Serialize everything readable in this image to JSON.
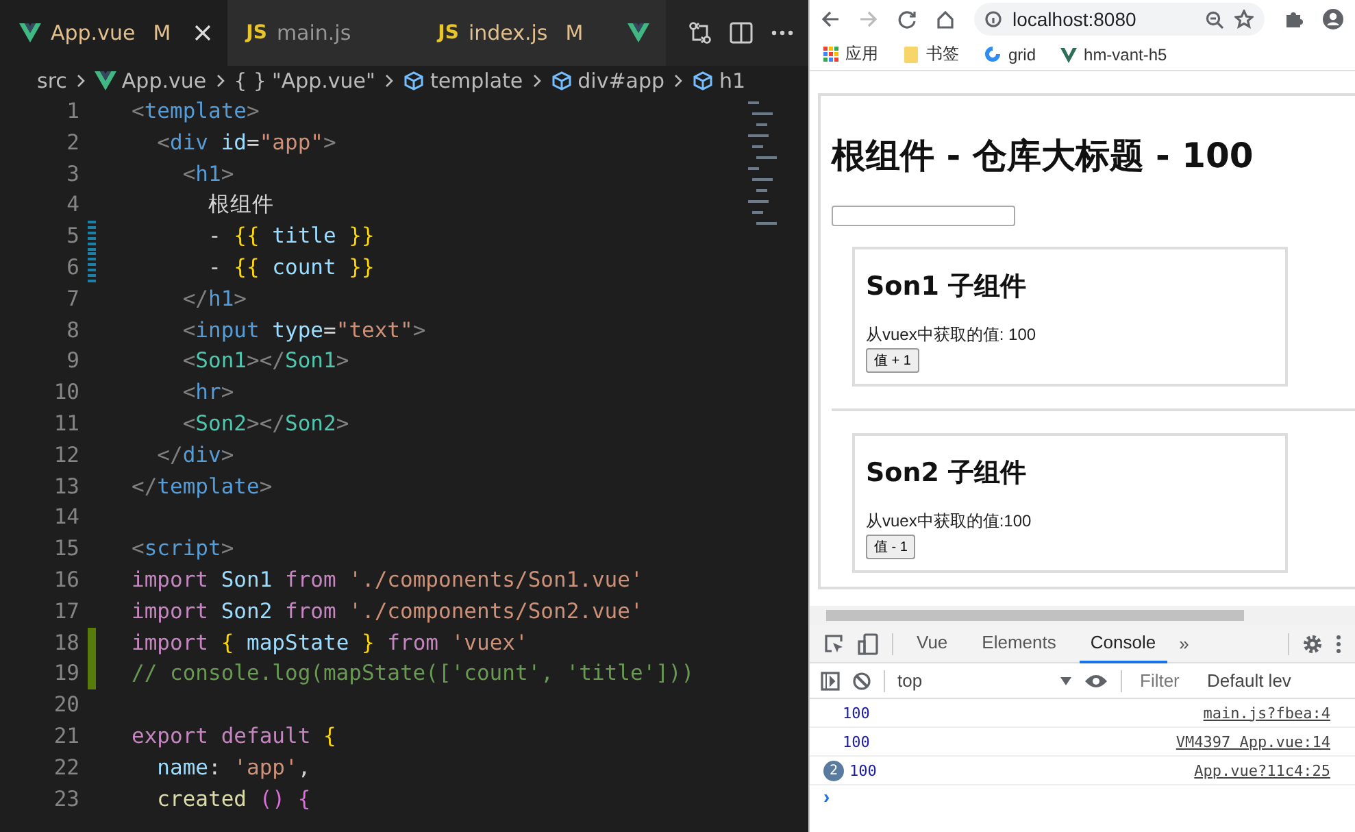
{
  "editor": {
    "tabs": [
      {
        "kind": "vue",
        "label": "App.vue",
        "badge": "M",
        "selected": true
      },
      {
        "kind": "js",
        "icon_text": "JS",
        "label": "main.js",
        "selected": false
      },
      {
        "kind": "js",
        "icon_text": "JS",
        "label": "index.js",
        "badge": "M",
        "selected": false
      },
      {
        "kind": "vue",
        "selected": false
      }
    ],
    "breadcrumb": [
      {
        "kind": "plain",
        "text": "src"
      },
      {
        "kind": "vue",
        "text": "App.vue"
      },
      {
        "kind": "braces",
        "icon_text": "{ }",
        "text": "\"App.vue\""
      },
      {
        "kind": "element",
        "text": "template"
      },
      {
        "kind": "element",
        "text": "div#app"
      },
      {
        "kind": "element",
        "text": "h1"
      }
    ],
    "lines": [
      {
        "number": "1",
        "modified": false,
        "added": false,
        "tokens": [
          {
            "kind": "punct",
            "text": "<"
          },
          {
            "kind": "tag",
            "text": "template"
          },
          {
            "kind": "punct",
            "text": ">"
          }
        ]
      },
      {
        "number": "2",
        "modified": false,
        "added": false,
        "tokens": [
          {
            "kind": "punct",
            "text": "  <"
          },
          {
            "kind": "tag",
            "text": "div"
          },
          {
            "kind": "attr",
            "text": " id"
          },
          {
            "kind": "text",
            "text": "="
          },
          {
            "kind": "string",
            "text": "\"app\""
          },
          {
            "kind": "punct",
            "text": ">"
          }
        ]
      },
      {
        "number": "3",
        "modified": false,
        "added": false,
        "tokens": [
          {
            "kind": "punct",
            "text": "    <"
          },
          {
            "kind": "tag",
            "text": "h1"
          },
          {
            "kind": "punct",
            "text": ">"
          }
        ]
      },
      {
        "number": "4",
        "modified": false,
        "added": false,
        "tokens": [
          {
            "kind": "text",
            "text": "      根组件"
          }
        ]
      },
      {
        "number": "5",
        "modified": true,
        "added": false,
        "tokens": [
          {
            "kind": "text",
            "text": "      - "
          },
          {
            "kind": "brace",
            "text": "{{"
          },
          {
            "kind": "var",
            "text": " title "
          },
          {
            "kind": "brace",
            "text": "}}"
          }
        ]
      },
      {
        "number": "6",
        "modified": true,
        "added": false,
        "tokens": [
          {
            "kind": "text",
            "text": "      - "
          },
          {
            "kind": "brace",
            "text": "{{"
          },
          {
            "kind": "var",
            "text": " count "
          },
          {
            "kind": "brace",
            "text": "}}"
          }
        ]
      },
      {
        "number": "7",
        "modified": false,
        "added": false,
        "tokens": [
          {
            "kind": "punct",
            "text": "    </"
          },
          {
            "kind": "tag",
            "text": "h1"
          },
          {
            "kind": "punct",
            "text": ">"
          }
        ]
      },
      {
        "number": "8",
        "modified": false,
        "added": false,
        "tokens": [
          {
            "kind": "punct",
            "text": "    <"
          },
          {
            "kind": "tag",
            "text": "input"
          },
          {
            "kind": "attr",
            "text": " type"
          },
          {
            "kind": "text",
            "text": "="
          },
          {
            "kind": "string",
            "text": "\"text\""
          },
          {
            "kind": "punct",
            "text": ">"
          }
        ]
      },
      {
        "number": "9",
        "modified": false,
        "added": false,
        "tokens": [
          {
            "kind": "punct",
            "text": "    <"
          },
          {
            "kind": "component",
            "text": "Son1"
          },
          {
            "kind": "punct",
            "text": "></"
          },
          {
            "kind": "component",
            "text": "Son1"
          },
          {
            "kind": "punct",
            "text": ">"
          }
        ]
      },
      {
        "number": "10",
        "modified": false,
        "added": false,
        "tokens": [
          {
            "kind": "punct",
            "text": "    <"
          },
          {
            "kind": "tag",
            "text": "hr"
          },
          {
            "kind": "punct",
            "text": ">"
          }
        ]
      },
      {
        "number": "11",
        "modified": false,
        "added": false,
        "tokens": [
          {
            "kind": "punct",
            "text": "    <"
          },
          {
            "kind": "component",
            "text": "Son2"
          },
          {
            "kind": "punct",
            "text": "></"
          },
          {
            "kind": "component",
            "text": "Son2"
          },
          {
            "kind": "punct",
            "text": ">"
          }
        ]
      },
      {
        "number": "12",
        "modified": false,
        "added": false,
        "tokens": [
          {
            "kind": "punct",
            "text": "  </"
          },
          {
            "kind": "tag",
            "text": "div"
          },
          {
            "kind": "punct",
            "text": ">"
          }
        ]
      },
      {
        "number": "13",
        "modified": false,
        "added": false,
        "tokens": [
          {
            "kind": "punct",
            "text": "</"
          },
          {
            "kind": "tag",
            "text": "template"
          },
          {
            "kind": "punct",
            "text": ">"
          }
        ]
      },
      {
        "number": "14",
        "modified": false,
        "added": false
      },
      {
        "number": "15",
        "modified": false,
        "added": false,
        "tokens": [
          {
            "kind": "punct",
            "text": "<"
          },
          {
            "kind": "tag",
            "text": "script"
          },
          {
            "kind": "punct",
            "text": ">"
          }
        ]
      },
      {
        "number": "16",
        "modified": false,
        "added": false,
        "tokens": [
          {
            "kind": "keyword",
            "text": "import"
          },
          {
            "kind": "var",
            "text": " Son1"
          },
          {
            "kind": "keyword",
            "text": " from"
          },
          {
            "kind": "string",
            "text": " './components/Son1.vue'"
          }
        ]
      },
      {
        "number": "17",
        "modified": false,
        "added": false,
        "tokens": [
          {
            "kind": "keyword",
            "text": "import"
          },
          {
            "kind": "var",
            "text": " Son2"
          },
          {
            "kind": "keyword",
            "text": " from"
          },
          {
            "kind": "string",
            "text": " './components/Son2.vue'"
          }
        ]
      },
      {
        "number": "18",
        "modified": false,
        "added": true,
        "tokens": [
          {
            "kind": "keyword",
            "text": "import"
          },
          {
            "kind": "brace",
            "text": " {"
          },
          {
            "kind": "var",
            "text": " mapState"
          },
          {
            "kind": "brace",
            "text": " }"
          },
          {
            "kind": "keyword",
            "text": " from"
          },
          {
            "kind": "string",
            "text": " 'vuex'"
          }
        ]
      },
      {
        "number": "19",
        "modified": false,
        "added": true,
        "tokens": [
          {
            "kind": "comment",
            "text": "// console.log(mapState(['count', 'title']))"
          }
        ]
      },
      {
        "number": "20",
        "modified": false,
        "added": false
      },
      {
        "number": "21",
        "modified": false,
        "added": false,
        "tokens": [
          {
            "kind": "keyword",
            "text": "export default"
          },
          {
            "kind": "brace",
            "text": " {"
          }
        ]
      },
      {
        "number": "22",
        "modified": false,
        "added": false,
        "tokens": [
          {
            "kind": "prop",
            "text": "  name"
          },
          {
            "kind": "text",
            "text": ": "
          },
          {
            "kind": "string",
            "text": "'app'"
          },
          {
            "kind": "text",
            "text": ","
          }
        ]
      },
      {
        "number": "23",
        "modified": false,
        "added": false,
        "tokens": [
          {
            "kind": "func",
            "text": "  created"
          },
          {
            "kind": "paren",
            "text": " ()"
          },
          {
            "kind": "paren",
            "text": " {"
          }
        ]
      }
    ]
  },
  "browser": {
    "address": "localhost:8080",
    "bookmarks": [
      {
        "kind": "apps",
        "label": "应用"
      },
      {
        "kind": "folder",
        "label": "书签"
      },
      {
        "kind": "grid",
        "label": "grid"
      },
      {
        "kind": "vue",
        "label": "hm-vant-h5"
      }
    ],
    "page": {
      "title": "根组件 - 仓库大标题 - 100",
      "components": [
        {
          "heading": "Son1 子组件",
          "text": "从vuex中获取的值: 100",
          "button": "值 + 1"
        },
        {
          "heading": "Son2 子组件",
          "text": "从vuex中获取的值:100",
          "button": "值 - 1"
        }
      ]
    },
    "devtools": {
      "tabs": [
        {
          "label": "Vue",
          "selected": false
        },
        {
          "label": "Elements",
          "selected": false
        },
        {
          "label": "Console",
          "selected": true
        }
      ],
      "more": "»",
      "context": "top",
      "filter_placeholder": "Filter",
      "levels": "Default lev",
      "messages": [
        {
          "value": "100",
          "source": "main.js?fbea:4"
        },
        {
          "value": "100",
          "source": "VM4397 App.vue:14"
        },
        {
          "count": "2",
          "value": "100",
          "source": "App.vue?11c4:25"
        }
      ],
      "prompt": "›"
    }
  }
}
